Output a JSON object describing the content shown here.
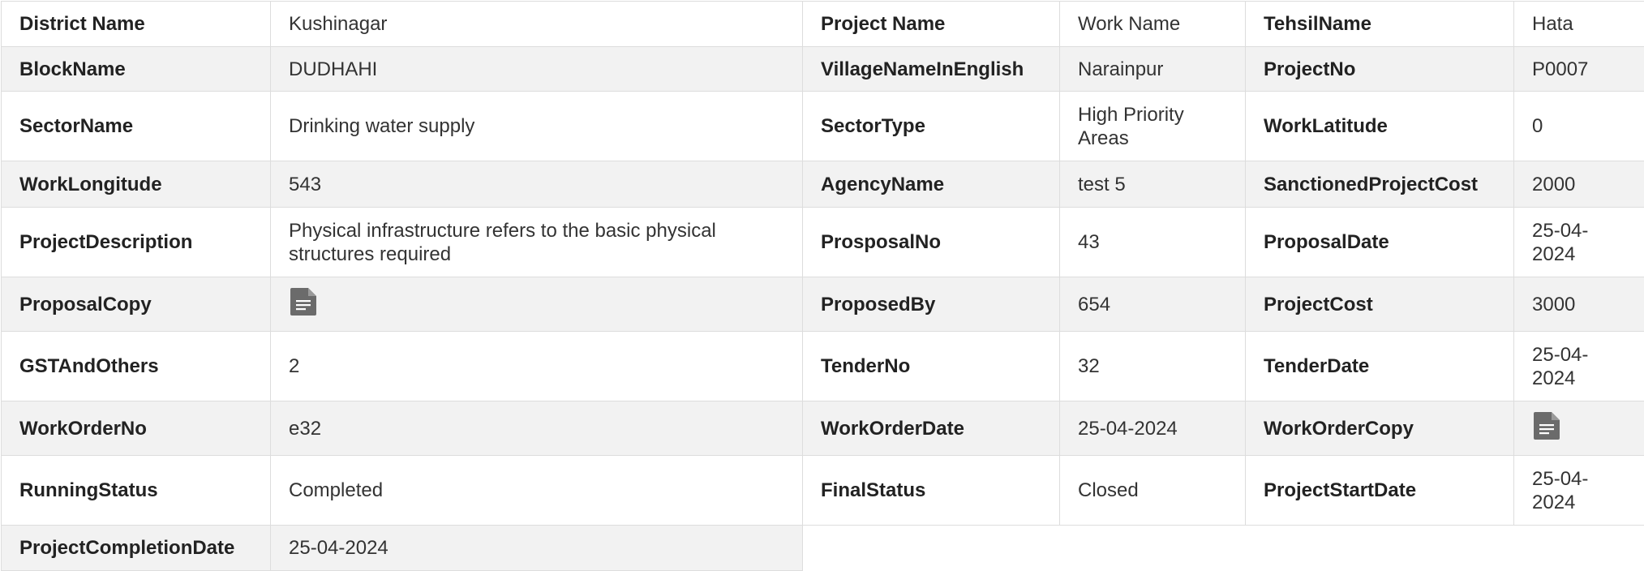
{
  "rows": [
    {
      "k1": "District Name",
      "v1": "Kushinagar",
      "k2": "Project Name",
      "v2": "Work Name",
      "k3": "TehsilName",
      "v3": "Hata"
    },
    {
      "k1": "BlockName",
      "v1": "DUDHAHI",
      "k2": "VillageNameInEnglish",
      "v2": "Narainpur",
      "k3": "ProjectNo",
      "v3": "P0007"
    },
    {
      "k1": "SectorName",
      "v1": "Drinking water supply",
      "k2": "SectorType",
      "v2": "High Priority Areas",
      "k3": "WorkLatitude",
      "v3": "0"
    },
    {
      "k1": "WorkLongitude",
      "v1": "543",
      "k2": "AgencyName",
      "v2": "test 5",
      "k3": "SanctionedProjectCost",
      "v3": "2000"
    },
    {
      "k1": "ProjectDescription",
      "v1": "Physical infrastructure refers to the basic physical structures required",
      "k2": "ProsposalNo",
      "v2": "43",
      "k3": "ProposalDate",
      "v3": "25-04-2024"
    },
    {
      "k1": "ProposalCopy",
      "v1_icon": "document-icon",
      "k2": "ProposedBy",
      "v2": "654",
      "k3": "ProjectCost",
      "v3": "3000"
    },
    {
      "k1": "GSTAndOthers",
      "v1": "2",
      "k2": "TenderNo",
      "v2": "32",
      "k3": "TenderDate",
      "v3": "25-04-2024"
    },
    {
      "k1": "WorkOrderNo",
      "v1": "e32",
      "k2": "WorkOrderDate",
      "v2": "25-04-2024",
      "k3": "WorkOrderCopy",
      "v3_icon": "document-icon"
    },
    {
      "k1": "RunningStatus",
      "v1": "Completed",
      "k2": "FinalStatus",
      "v2": "Closed",
      "k3": "ProjectStartDate",
      "v3": "25-04-2024"
    },
    {
      "k1": "ProjectCompletionDate",
      "v1": "25-04-2024"
    }
  ],
  "colors": {
    "border": "#dddddd",
    "stripe": "#f2f2f2",
    "icon": "#6b6b6b"
  }
}
